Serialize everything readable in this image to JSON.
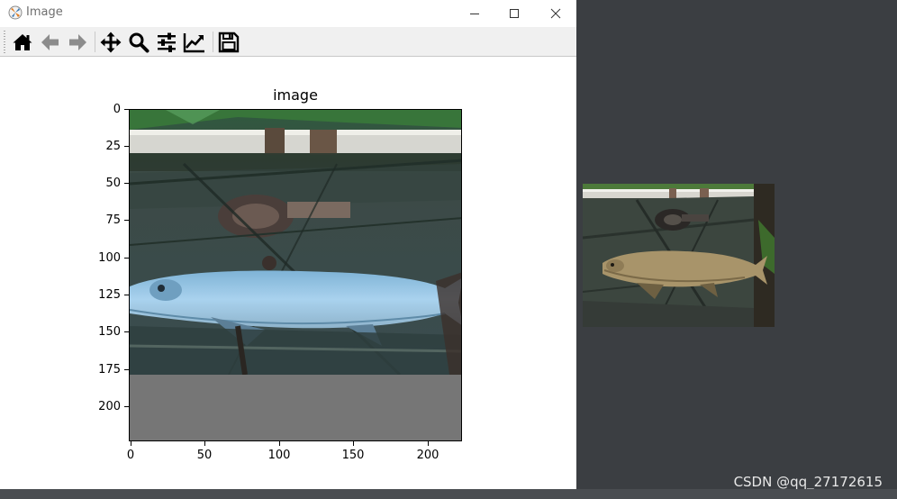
{
  "window": {
    "title": "Image",
    "controls": [
      "minimize",
      "maximize",
      "close"
    ]
  },
  "toolbar": {
    "buttons": [
      {
        "name": "home",
        "icon": "home-icon"
      },
      {
        "name": "back",
        "icon": "arrow-left-icon"
      },
      {
        "name": "forward",
        "icon": "arrow-right-icon"
      },
      {
        "name": "pan",
        "icon": "move-icon"
      },
      {
        "name": "zoom",
        "icon": "magnifier-icon"
      },
      {
        "name": "subplots",
        "icon": "sliders-icon"
      },
      {
        "name": "edit-axes",
        "icon": "line-chart-icon"
      },
      {
        "name": "save",
        "icon": "floppy-disk-icon"
      }
    ]
  },
  "plot": {
    "title": "image",
    "yticks": [
      "0",
      "25",
      "50",
      "75",
      "100",
      "125",
      "150",
      "175",
      "200"
    ],
    "xticks": [
      "0",
      "50",
      "100",
      "150",
      "200"
    ]
  },
  "colors": {
    "desktop": "#3b3e42",
    "toolbar": "#f0f0f0",
    "padding_gray": "#767676"
  },
  "watermark": "CSDN @qq_27172615"
}
